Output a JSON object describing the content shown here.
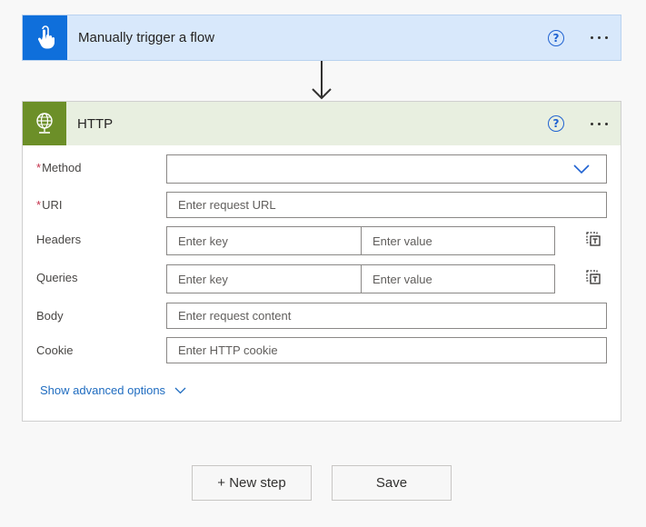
{
  "trigger": {
    "title": "Manually trigger a flow",
    "icon": "touch-hand-icon",
    "color": "#0f6fdb"
  },
  "http": {
    "title": "HTTP",
    "icon": "globe-icon",
    "color": "#6c8f28",
    "fields": {
      "method": {
        "label": "Method",
        "required": "*",
        "value": ""
      },
      "uri": {
        "label": "URI",
        "required": "*",
        "placeholder": "Enter request URL"
      },
      "headers": {
        "label": "Headers",
        "key_placeholder": "Enter key",
        "value_placeholder": "Enter value"
      },
      "queries": {
        "label": "Queries",
        "key_placeholder": "Enter key",
        "value_placeholder": "Enter value"
      },
      "body": {
        "label": "Body",
        "placeholder": "Enter request content"
      },
      "cookie": {
        "label": "Cookie",
        "placeholder": "Enter HTTP cookie"
      }
    },
    "advanced_link": "Show advanced options"
  },
  "help_glyph": "?",
  "buttons": {
    "new_step": "+ New step",
    "save": "Save"
  }
}
